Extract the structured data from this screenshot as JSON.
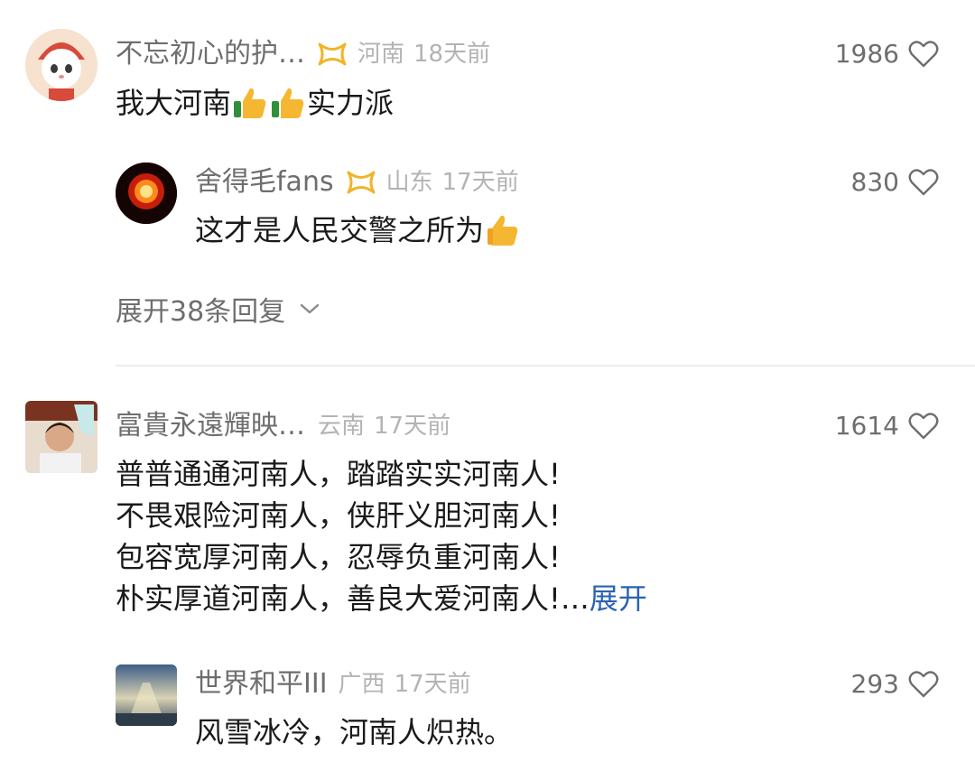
{
  "comments": [
    {
      "username": "不忘初心的护…",
      "location": "河南",
      "time": "18天前",
      "likes": "1986",
      "text_before": "我大河南",
      "text_after": "实力派",
      "reply": {
        "username": "舍得毛fans",
        "location": "山东",
        "time": "17天前",
        "likes": "830",
        "text": "这才是人民交警之所为"
      },
      "expand_replies": "展开38条回复"
    },
    {
      "username": "富貴永遠輝映…",
      "location": "云南",
      "time": "17天前",
      "likes": "1614",
      "lines": [
        "普普通通河南人，踏踏实实河南人!",
        "不畏艰险河南人，侠肝义胆河南人!",
        "包容宽厚河南人，忍辱负重河南人!",
        "朴实厚道河南人，善良大爱河南人!…"
      ],
      "more": "展开",
      "reply": {
        "username": "世界和平III",
        "location": "广西",
        "time": "17天前",
        "likes": "293",
        "text": "风雪冰冷，河南人炽热。"
      }
    }
  ],
  "colors": {
    "username": "#6e6e6e",
    "meta": "#b3b3b3",
    "badge": "#f0b429",
    "link": "#2b62b3",
    "divider": "#eeeeee"
  },
  "icons": {
    "badge": "vip-badge-icon",
    "like": "heart-outline-icon",
    "thumbs": "thumbs-up-emoji",
    "chevron": "chevron-down-icon"
  }
}
